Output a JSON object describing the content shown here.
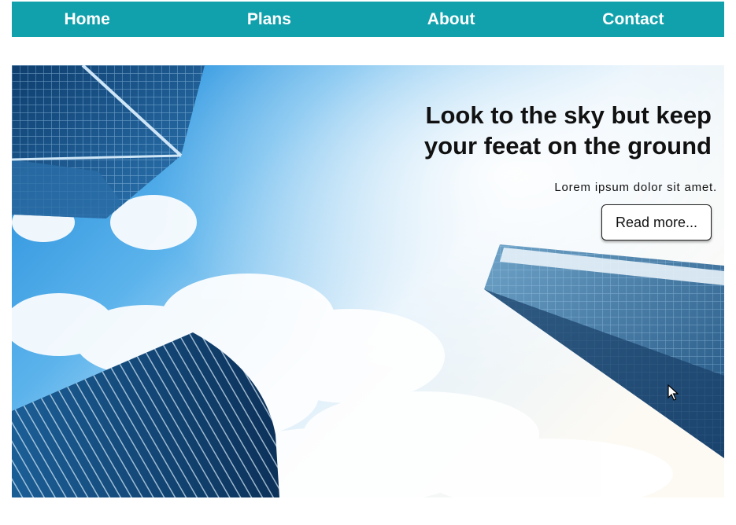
{
  "nav": {
    "items": [
      {
        "label": "Home"
      },
      {
        "label": "Plans"
      },
      {
        "label": "About"
      },
      {
        "label": "Contact"
      }
    ],
    "color": "#11a1ac"
  },
  "hero": {
    "headline": "Look to the sky but keep your feeat on the ground",
    "subtext": "Lorem ipsum dolor sit amet.",
    "button_label": "Read more...",
    "background_image": "skyscrapers-against-cloudy-sky"
  },
  "icons": {
    "cursor": "mouse-pointer-icon"
  }
}
